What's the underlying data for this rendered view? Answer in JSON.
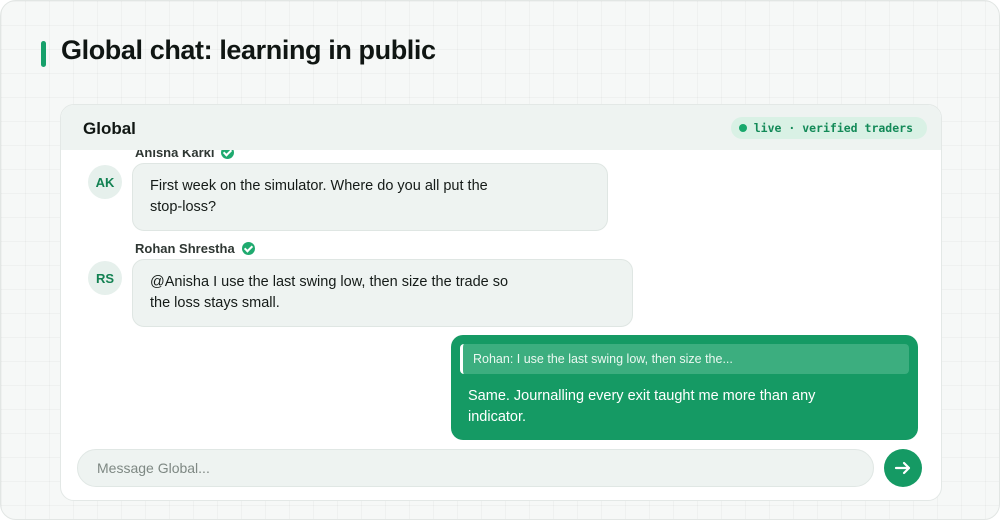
{
  "page": {
    "title": "Global chat: learning in public"
  },
  "chat": {
    "name": "Global",
    "status": "live · verified traders"
  },
  "messages": [
    {
      "sender": "Anisha Karki",
      "initials": "AK",
      "verified": true,
      "direction": "incoming",
      "lines": [
        "First week on the simulator. Where do you all put the",
        "stop-loss?"
      ]
    },
    {
      "sender": "Rohan Shrestha",
      "initials": "RS",
      "verified": true,
      "direction": "incoming",
      "lines": [
        "@Anisha I use the last swing low, then size the trade so",
        "the loss stays small."
      ]
    },
    {
      "direction": "outgoing",
      "reply_to": "Rohan: I use the last swing low, then size the...",
      "lines": [
        "Same. Journalling every exit taught me more than any",
        "indicator."
      ]
    }
  ],
  "composer": {
    "placeholder": "Message Global..."
  },
  "icons": {
    "verified": "check-circle-icon",
    "send": "arrow-right-icon"
  },
  "colors": {
    "accent": "#159a64",
    "incoming_bubble": "#eef3f1",
    "status_bg": "#d9f1e5"
  }
}
